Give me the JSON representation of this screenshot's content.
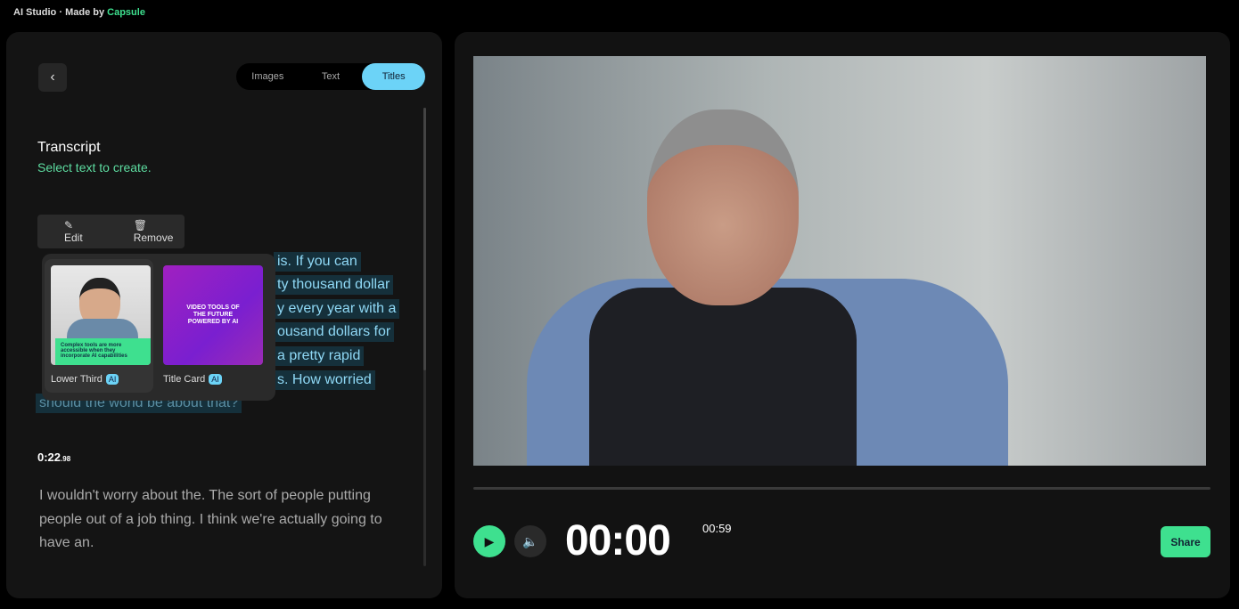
{
  "app": {
    "title": "AI Studio",
    "separator": "·",
    "made_by": "Made by",
    "brand": "Capsule"
  },
  "tabs": [
    {
      "label": "Images"
    },
    {
      "label": "Text"
    },
    {
      "label": "Titles",
      "active": true
    }
  ],
  "transcript": {
    "title": "Transcript",
    "hint": "Select text to create.",
    "highlighted_lines": [
      "is. If you can",
      "ty thousand dollar",
      "y every year with a",
      "ousand dollars for",
      "a pretty rapid",
      "s. How worried",
      "should the world be about that?"
    ],
    "timestamp": "0:22",
    "timestamp_fraction": ".98",
    "paragraph": "I wouldn't worry about the. The sort of people putting people out of a job thing. I think we're actually going to have an."
  },
  "selection_toolbar": {
    "edit": "Edit",
    "remove": "Remove"
  },
  "title_options": [
    {
      "label": "Lower Third",
      "badge": "AI",
      "thumb_text": "Complex tools are more accessible when they incorporate AI capabilities"
    },
    {
      "label": "Title Card",
      "badge": "AI",
      "thumb_text": "VIDEO TOOLS OF THE FUTURE POWERED BY AI"
    }
  ],
  "player": {
    "current_time": "00:00",
    "duration": "00:59",
    "progress": 0,
    "share": "Share"
  },
  "colors": {
    "accent_green": "#3ee08f",
    "accent_blue": "#6cd3f7"
  }
}
